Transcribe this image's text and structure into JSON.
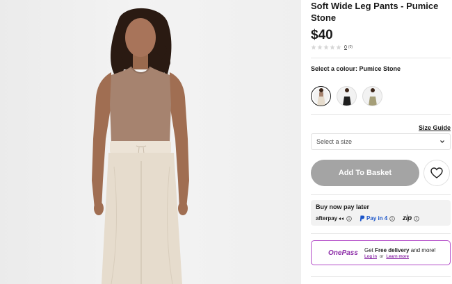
{
  "product": {
    "title": "Soft Wide Leg Pants - Pumice Stone",
    "price": "$40",
    "rating": {
      "value": 0,
      "count": "0",
      "count_paren": "(0)"
    },
    "image_alt": "model wearing soft wide leg pants in pumice stone"
  },
  "colour": {
    "label": "Select a colour: Pumice Stone",
    "swatches": [
      {
        "name": "Pumice Stone",
        "selected": true,
        "pant_color": "#e6dccd"
      },
      {
        "name": "Black",
        "selected": false,
        "pant_color": "#1e1e1e"
      },
      {
        "name": "Olive",
        "selected": false,
        "pant_color": "#a59e78"
      }
    ]
  },
  "size": {
    "guide_label": "Size Guide",
    "placeholder": "Select a size"
  },
  "actions": {
    "basket_label": "Add To Basket"
  },
  "bnpl": {
    "title": "Buy now pay later",
    "afterpay": "afterpay",
    "paypal": "Pay in 4",
    "zip": "zip"
  },
  "onepass": {
    "logo": "OnePass",
    "text_prefix": "Get ",
    "text_bold": "Free delivery",
    "text_suffix": " and more!",
    "login": "Log in",
    "or": "or",
    "learn_more": "Learn more"
  },
  "colors": {
    "button_disabled": "#a4a4a4",
    "onepass_accent": "#8d2ea8",
    "paypal_blue": "#1a54c9"
  }
}
